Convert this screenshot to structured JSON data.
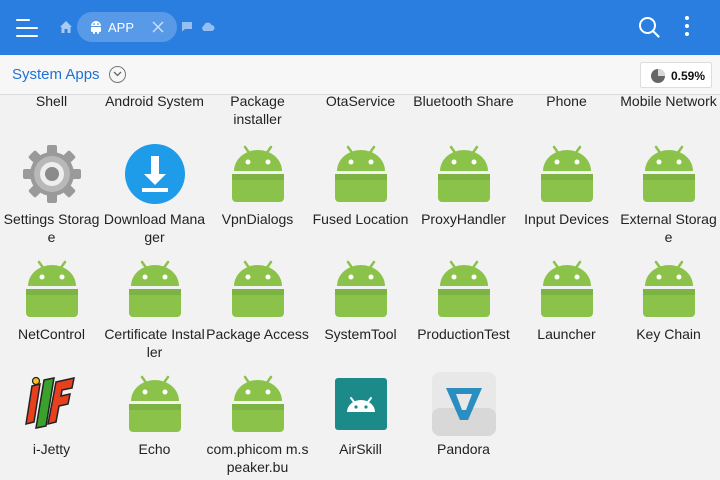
{
  "header": {
    "tab_label": "APP",
    "accent_color": "#2a7ee0"
  },
  "subheader": {
    "title": "System Apps",
    "storage_percent": "0.59%"
  },
  "partial_row": [
    {
      "label": "Shell"
    },
    {
      "label": "Android System"
    },
    {
      "label": "Package installer"
    },
    {
      "label": "OtaService"
    },
    {
      "label": "Bluetooth Share"
    },
    {
      "label": "Phone"
    },
    {
      "label": "Mobile Network"
    }
  ],
  "apps": [
    {
      "label": "Settings Storage",
      "icon": "gear-icon"
    },
    {
      "label": "Download Manager",
      "icon": "download-icon"
    },
    {
      "label": "VpnDialogs",
      "icon": "android-icon"
    },
    {
      "label": "Fused Location",
      "icon": "android-icon"
    },
    {
      "label": "ProxyHandler",
      "icon": "android-icon"
    },
    {
      "label": "Input Devices",
      "icon": "android-icon"
    },
    {
      "label": "External Storage",
      "icon": "android-icon"
    },
    {
      "label": "NetControl",
      "icon": "android-icon"
    },
    {
      "label": "Certificate Installer",
      "icon": "android-icon"
    },
    {
      "label": "Package Access",
      "icon": "android-icon"
    },
    {
      "label": "SystemTool",
      "icon": "android-icon"
    },
    {
      "label": "ProductionTest",
      "icon": "android-icon"
    },
    {
      "label": "Launcher",
      "icon": "android-icon"
    },
    {
      "label": "Key Chain",
      "icon": "android-icon"
    },
    {
      "label": "i-Jetty",
      "icon": "ijetty-icon"
    },
    {
      "label": "Echo",
      "icon": "android-icon"
    },
    {
      "label": "com.phicom m.speaker.bu",
      "icon": "android-icon"
    },
    {
      "label": "AirSkill",
      "icon": "airskill-icon"
    },
    {
      "label": "Pandora",
      "icon": "pandora-icon"
    }
  ]
}
